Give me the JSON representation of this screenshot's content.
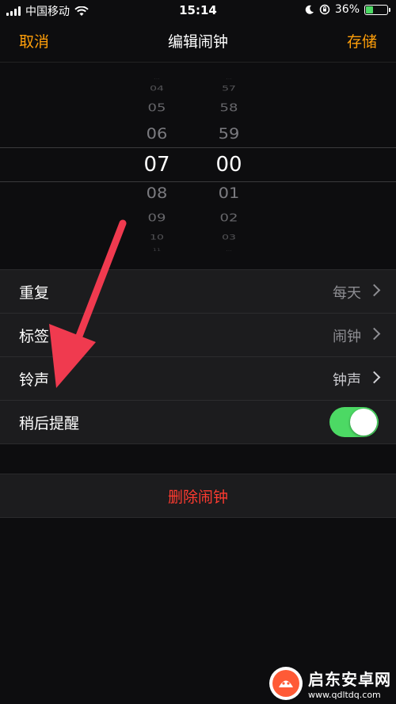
{
  "status": {
    "carrier": "中国移动",
    "time": "15:14",
    "battery_percent": "36%",
    "battery_level": 0.36,
    "icons": [
      "signal-icon",
      "wifi-icon",
      "moon-icon",
      "orientation-lock-icon",
      "battery-icon"
    ]
  },
  "nav": {
    "cancel": "取消",
    "title": "编辑闹钟",
    "save": "存储",
    "accent": "#ff9f0a"
  },
  "picker": {
    "hours": [
      "...",
      "04",
      "05",
      "06",
      "07",
      "08",
      "09",
      "10",
      "11"
    ],
    "minutes": [
      "...",
      "57",
      "58",
      "59",
      "00",
      "01",
      "02",
      "03",
      "..."
    ],
    "selected_hour": "07",
    "selected_minute": "00"
  },
  "settings": {
    "repeat": {
      "label": "重复",
      "value": "每天"
    },
    "label": {
      "label": "标签",
      "value": "闹钟"
    },
    "sound": {
      "label": "铃声",
      "value": "钟声"
    },
    "snooze": {
      "label": "稍后提醒",
      "on": true,
      "color": "#4cd964"
    }
  },
  "delete": {
    "label": "删除闹钟",
    "color": "#ff3b30"
  },
  "annotation": {
    "arrow_color": "#f03a4f"
  },
  "watermark": {
    "title": "启东安卓网",
    "url": "www.qdltdq.com"
  }
}
